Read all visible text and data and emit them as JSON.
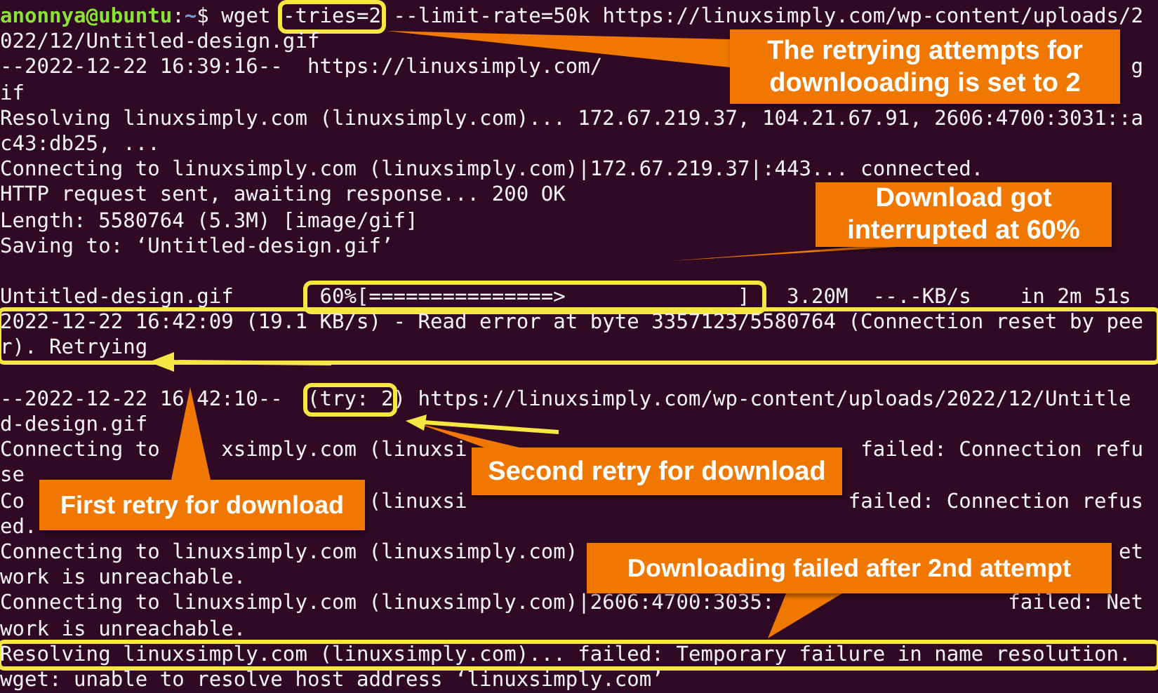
{
  "terminal": {
    "blocks": [
      {
        "boxed": false,
        "lines": [
          {
            "runs": [
              {
                "text": "anonnya@ubuntu",
                "kind": "user"
              },
              {
                "text": ":",
                "kind": "plain"
              },
              {
                "text": "~",
                "kind": "path"
              },
              {
                "text": "$ wget ",
                "kind": "plain"
              },
              {
                "text": "-tries=2",
                "kind": "highlight"
              },
              {
                "text": " --limit-rate=50k https://linuxsimply.com/wp-content/uploads/2",
                "kind": "plain"
              }
            ]
          },
          {
            "runs": [
              {
                "text": "022/12/Untitled-design.gif",
                "kind": "plain"
              }
            ]
          },
          {
            "runs": [
              {
                "text": "--2022-12-22 16:39:16--  https://linuxsimply.com/",
                "kind": "plain"
              },
              {
                "text": "g",
                "kind": "plain"
              }
            ]
          },
          {
            "runs": [
              {
                "text": "if",
                "kind": "plain"
              }
            ]
          },
          {
            "runs": [
              {
                "text": "Resolving linuxsimply.com (linuxsimply.com)... 172.67.219.37, 104.21.67.91, 2606:4700:3031::a",
                "kind": "plain"
              }
            ]
          },
          {
            "runs": [
              {
                "text": "c43:db25, ...",
                "kind": "plain"
              }
            ]
          },
          {
            "runs": [
              {
                "text": "Connecting to linuxsimply.com (linuxsimply.com)|172.67.219.37|:443... connected.",
                "kind": "plain"
              }
            ]
          },
          {
            "runs": [
              {
                "text": "HTTP request sent, awaiting response... 200 OK",
                "kind": "plain"
              }
            ]
          },
          {
            "runs": [
              {
                "text": "Length: 5580764 (5.3M) [image/gif]",
                "kind": "plain"
              }
            ]
          },
          {
            "runs": [
              {
                "text": "Saving to: ‘Untitled-design.gif’",
                "kind": "plain"
              }
            ]
          },
          {
            "blank_before": true,
            "runs": [
              {
                "text": "Untitled-design.gif      ",
                "kind": "plain"
              },
              {
                "text": " 60%[===============>              ] ",
                "kind": "highlight"
              },
              {
                "text": "  3.20M  --.-KB/s    in 2m 51s",
                "kind": "plain"
              }
            ]
          }
        ]
      },
      {
        "boxed": true,
        "lines": [
          {
            "runs": [
              {
                "text": "2022-12-22 16:42:09 (19.1 KB/s) - Read error at byte 3357123/5580764 (Connection reset by pee",
                "kind": "plain"
              }
            ]
          },
          {
            "runs": [
              {
                "text": "r). Retrying",
                "kind": "plain"
              }
            ]
          }
        ]
      },
      {
        "boxed": false,
        "lines": [
          {
            "blank_before": true,
            "runs": [
              {
                "text": "--2022-12-22 16",
                "kind": "plain"
              },
              {
                "text": "42:10--  ",
                "kind": "plain"
              },
              {
                "text": "(try: 2",
                "kind": "highlight"
              },
              {
                "text": ") https://linuxsimply.com/wp-content/uploads/2022/12/Untitle",
                "kind": "plain"
              }
            ]
          },
          {
            "runs": [
              {
                "text": "d-design.gif",
                "kind": "plain"
              }
            ]
          },
          {
            "runs": [
              {
                "text": "Connecting to ",
                "kind": "plain"
              },
              {
                "text": "xsimply.com (linuxsi",
                "kind": "plain"
              },
              {
                "text": "failed: Connection refu",
                "kind": "plain"
              }
            ]
          },
          {
            "runs": [
              {
                "text": "se",
                "kind": "plain"
              }
            ]
          },
          {
            "runs": [
              {
                "text": "Co",
                "kind": "plain"
              },
              {
                "text": "(linuxsi",
                "kind": "plain"
              },
              {
                "text": "failed: Connection refus",
                "kind": "plain"
              }
            ]
          },
          {
            "runs": [
              {
                "text": "ed.",
                "kind": "plain"
              }
            ]
          },
          {
            "runs": [
              {
                "text": "Connecting to linuxsimply.com (linuxsimply.com)",
                "kind": "plain"
              },
              {
                "text": "et",
                "kind": "plain"
              }
            ]
          },
          {
            "runs": [
              {
                "text": "work is unreachable.",
                "kind": "plain"
              }
            ]
          },
          {
            "runs": [
              {
                "text": "Connecting to linuxsimply.com (linuxsimply.com)|2606:4700:3035:",
                "kind": "plain"
              },
              {
                "text": "failed: Net",
                "kind": "plain"
              }
            ]
          },
          {
            "runs": [
              {
                "text": "work is unreachable.",
                "kind": "plain"
              }
            ]
          }
        ]
      },
      {
        "boxed": true,
        "lines": [
          {
            "runs": [
              {
                "text": "Resolving linuxsimply.com (linuxsimply.com)... failed: Temporary failure in name resolution.",
                "kind": "plain"
              }
            ]
          }
        ]
      },
      {
        "boxed": false,
        "lines": [
          {
            "runs": [
              {
                "text": "wget: unable to resolve host address ‘linuxsimply.com’",
                "kind": "plain"
              }
            ]
          }
        ]
      }
    ]
  },
  "callouts": [
    {
      "lines": [
        "The retrying attempts for",
        "downlooading is set to 2"
      ]
    },
    {
      "lines": [
        "Download got",
        "interrupted at 60%"
      ]
    },
    {
      "lines": [
        "Second retry for download"
      ]
    },
    {
      "lines": [
        "First retry for download"
      ]
    },
    {
      "lines": [
        "Downloading failed after 2nd attempt"
      ]
    }
  ]
}
